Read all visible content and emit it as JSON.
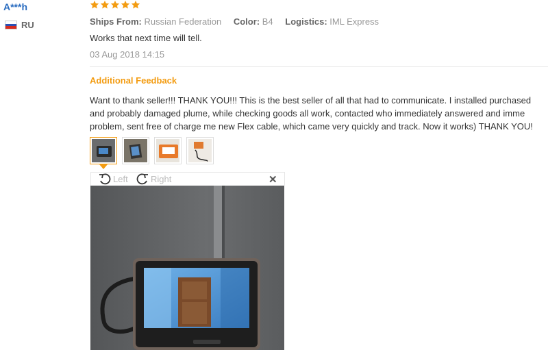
{
  "review": {
    "user": "A***h",
    "country": "RU",
    "rating": 5,
    "ships_from_label": "Ships From:",
    "ships_from": "Russian Federation",
    "color_label": "Color:",
    "color": "B4",
    "logistics_label": "Logistics:",
    "logistics": "IML Express",
    "text": "Works that next time will tell.",
    "date": "03 Aug 2018 14:15"
  },
  "feedback": {
    "title": "Additional Feedback",
    "lines": [
      "Want to thank seller!!! THANK YOU!!! This is the best seller of all that had to communicate. I installed purchased",
      "and probably damaged plume, while checking goods all work, contacted who immediately answered and imme",
      "problem, sent free of charge me new Flex cable, which came very quickly and track. Now it works) THANK YOU!"
    ]
  },
  "viewer": {
    "rotate_left": "Left",
    "rotate_right": "Right",
    "close_icon": "close-icon",
    "selected_thumbnail": 1,
    "thumbnail_count": 4
  },
  "colors": {
    "username": "#2a6cc0",
    "star": "#f39c12",
    "accent": "#f39c12"
  }
}
